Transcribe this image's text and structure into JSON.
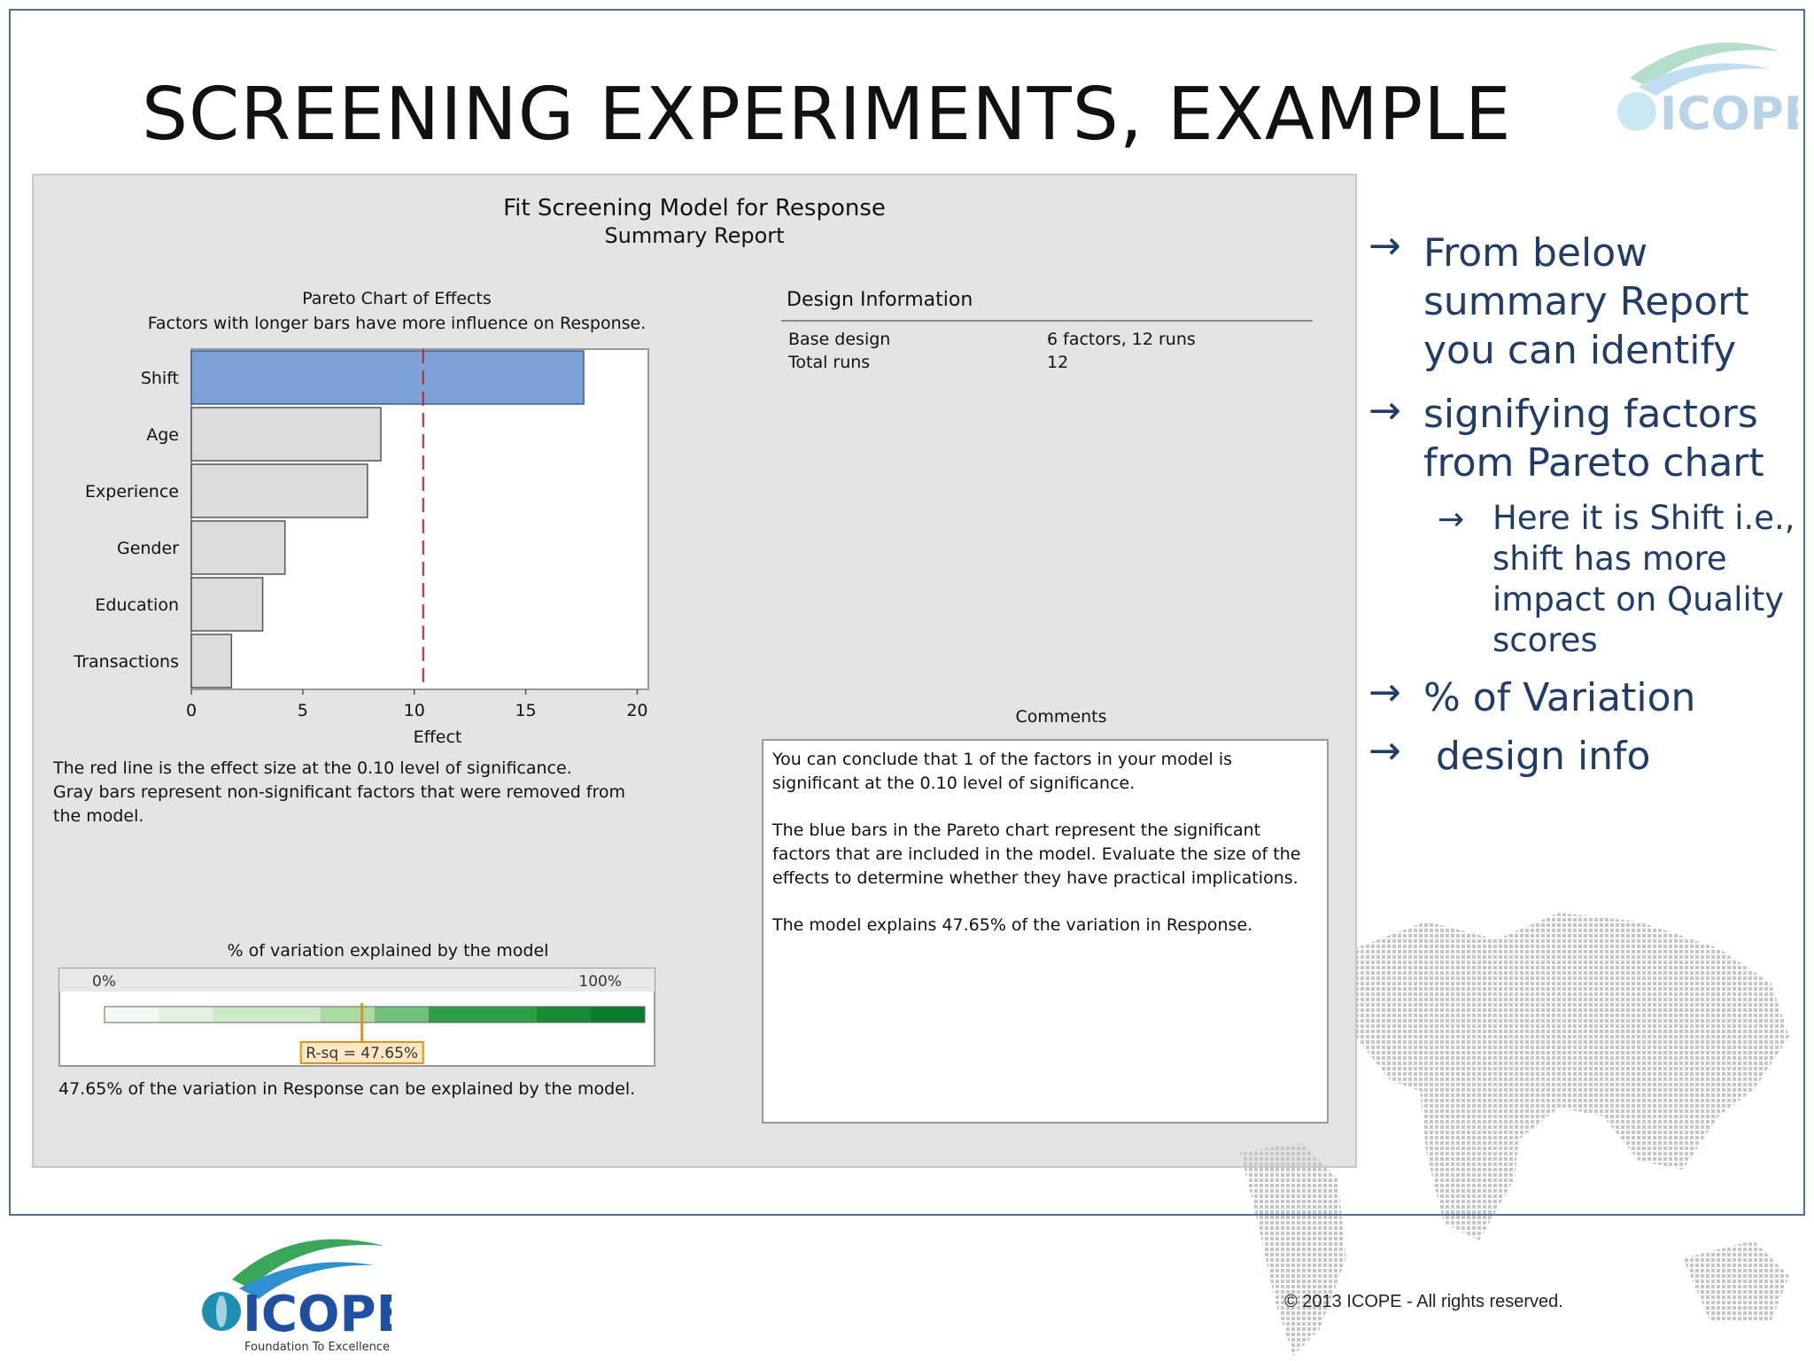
{
  "slide": {
    "title": "SCREENING EXPERIMENTS, EXAMPLE",
    "copyright": "©  2013 ICOPE - All rights reserved.",
    "logo_text": "ICOPE",
    "logo_tagline": "Foundation To Excellence"
  },
  "report": {
    "title": "Fit Screening Model for Response",
    "subtitle": "Summary Report",
    "pareto_title": "Pareto Chart of Effects",
    "pareto_subtitle": "Factors with longer bars have more influence on Response.",
    "note_lines": [
      "The red line is the effect size at the 0.10 level of significance.",
      "Gray bars represent non-significant factors that were removed from",
      "the model."
    ],
    "variation_title": "% of variation explained by the model",
    "variation_min_label": "0%",
    "variation_max_label": "100%",
    "variation_rsq_label": "R-sq = 47.65%",
    "variation_value_pct": 47.65,
    "variation_caption": "47.65% of the variation in Response can be explained by the model.",
    "design_title": "Design Information",
    "design_rows": [
      {
        "label": "Base design",
        "value": "6 factors, 12 runs"
      },
      {
        "label": "Total runs",
        "value": "12"
      }
    ],
    "comments_title": "Comments",
    "comments": [
      "You can conclude that 1 of the factors in your model is significant at the 0.10 level of significance.",
      "The blue bars in the Pareto chart represent the significant factors that are included in the model. Evaluate the size of the effects to determine whether they have practical implications.",
      "The model explains 47.65% of the variation in Response."
    ]
  },
  "bullets": {
    "b1_lines": [
      "From below",
      "summary Report",
      "you can identify"
    ],
    "b2_lines": [
      "signifying factors",
      "from Pareto chart"
    ],
    "sub_lines": [
      "Here it is Shift i.e.,",
      "shift has more",
      "impact on Quality",
      "scores"
    ],
    "b3": "% of Variation",
    "b4": " design info"
  },
  "chart_data": {
    "type": "bar",
    "orientation": "horizontal",
    "title": "Pareto Chart of Effects",
    "xlabel": "Effect",
    "categories": [
      "Shift",
      "Age",
      "Experience",
      "Gender",
      "Education",
      "Transactions"
    ],
    "values": [
      17.6,
      8.5,
      7.9,
      4.2,
      3.2,
      1.8
    ],
    "significant": [
      true,
      false,
      false,
      false,
      false,
      false
    ],
    "reference_line": 10.4,
    "xlim": [
      0,
      20.5
    ],
    "xticks": [
      0,
      5,
      10,
      15,
      20
    ],
    "colors": {
      "significant": "#7ea1d6",
      "nonsignificant": "#dcdcdc",
      "reference": "#c0262c"
    }
  }
}
